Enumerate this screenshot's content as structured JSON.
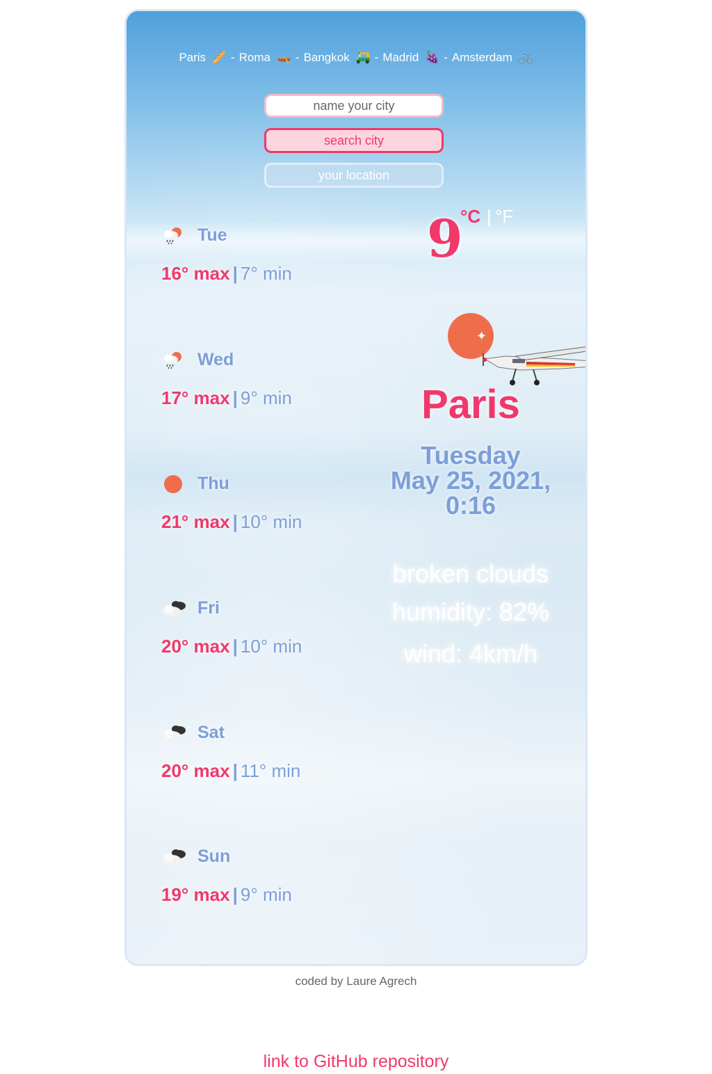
{
  "colors": {
    "accent_pink": "#f0386b",
    "accent_blue": "#7d9ed9",
    "sun_orange": "#ee6e4c",
    "sky_top": "#4fa0dc"
  },
  "city_links": [
    {
      "label": "Paris",
      "emoji": "🥖"
    },
    {
      "label": "Roma",
      "emoji": "🛶"
    },
    {
      "label": "Bangkok",
      "emoji": "🛺"
    },
    {
      "label": "Madrid",
      "emoji": "🍇"
    },
    {
      "label": "Amsterdam",
      "emoji": "🚲"
    }
  ],
  "city_link_separator": "-",
  "search": {
    "placeholder": "name your city",
    "search_label": "search city",
    "location_label": "your location"
  },
  "forecast": [
    {
      "day": "Tue",
      "icon": "rain-sun-icon",
      "max": "16° max",
      "bar": "|",
      "min": "7° min"
    },
    {
      "day": "Wed",
      "icon": "rain-sun-icon",
      "max": "17° max",
      "bar": "|",
      "min": "9° min"
    },
    {
      "day": "Thu",
      "icon": "sun-icon",
      "max": "21° max",
      "bar": "|",
      "min": "10° min"
    },
    {
      "day": "Fri",
      "icon": "broken-clouds-icon",
      "max": "20° max",
      "bar": "|",
      "min": "10° min"
    },
    {
      "day": "Sat",
      "icon": "broken-clouds-icon",
      "max": "20° max",
      "bar": "|",
      "min": "11° min"
    },
    {
      "day": "Sun",
      "icon": "broken-clouds-icon",
      "max": "19° max",
      "bar": "|",
      "min": "9° min"
    }
  ],
  "current": {
    "temperature": "9",
    "unit_c": "°C",
    "unit_separator": "|",
    "unit_f": "°F",
    "icon": "sun-icon",
    "city": "Paris",
    "weekday": "Tuesday",
    "date": "May 25, 2021,",
    "time": "0:16",
    "description": "broken clouds",
    "humidity": "humidity: 82%",
    "wind": "wind: 4km/h"
  },
  "footer": {
    "credit": "coded by Laure Agrech",
    "repo_link": "link to GitHub repository"
  }
}
